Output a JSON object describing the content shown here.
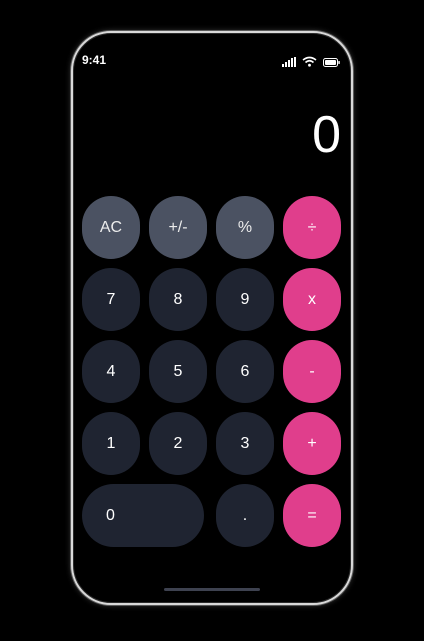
{
  "status_bar": {
    "time": "9:41",
    "icons": [
      "signal-icon",
      "wifi-icon",
      "battery-icon"
    ]
  },
  "display": {
    "value": "0"
  },
  "keypad": {
    "rows": [
      [
        "AC",
        "+/-",
        "%",
        "÷"
      ],
      [
        "7",
        "8",
        "9",
        "x"
      ],
      [
        "4",
        "5",
        "6",
        "-"
      ],
      [
        "1",
        "2",
        "3",
        "+"
      ],
      [
        "0",
        ".",
        "="
      ]
    ]
  },
  "colors": {
    "function_key": "#4b5262",
    "number_key": "#1f2431",
    "operator_key": "#e03e8c",
    "background": "#000000"
  }
}
